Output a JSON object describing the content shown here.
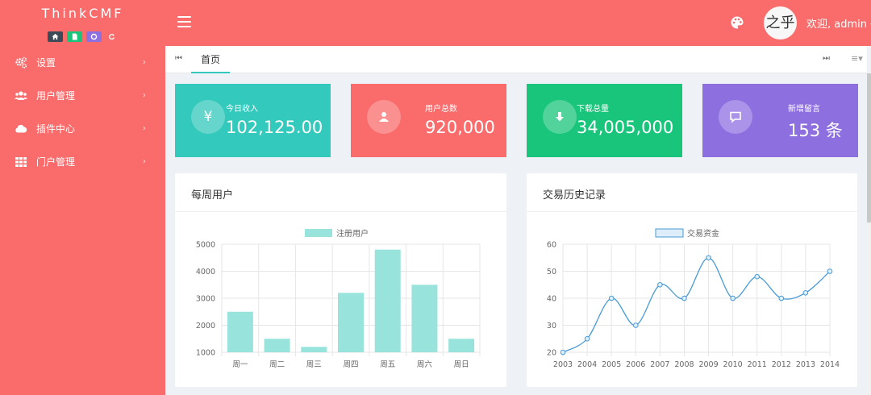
{
  "sidebar": {
    "brand": "ThinkCMF",
    "quick_buttons": [
      {
        "icon": "home-icon",
        "color": "#3d4a57"
      },
      {
        "icon": "document-icon",
        "color": "#19c57a"
      },
      {
        "icon": "recycle-icon",
        "color": "#8e6fe0"
      },
      {
        "icon": "refresh-icon",
        "color": "transparent"
      }
    ],
    "items": [
      {
        "label": "设置",
        "icon": "gears-icon"
      },
      {
        "label": "用户管理",
        "icon": "users-icon"
      },
      {
        "label": "插件中心",
        "icon": "cloud-icon"
      },
      {
        "label": "门户管理",
        "icon": "grid-icon"
      }
    ]
  },
  "navbar": {
    "welcome": "欢迎, admin",
    "avatar_text": "之乎",
    "theme_icon": "palette-icon",
    "menu_icon": "hamburger-icon"
  },
  "tabs": {
    "home": "首页",
    "prev_icon": "⏮",
    "next_icon": "⏭",
    "menu_icon": "≡▾"
  },
  "stats": [
    {
      "label": "今日收入",
      "value": "102,125.00",
      "icon": "yen-icon",
      "color": "#33c9bc"
    },
    {
      "label": "用户总数",
      "value": "920,000",
      "icon": "user-icon",
      "color": "#fa6b6b"
    },
    {
      "label": "下载总量",
      "value": "34,005,000",
      "icon": "download-icon",
      "color": "#19c57a"
    },
    {
      "label": "新增留言",
      "value": "153 条",
      "icon": "comment-icon",
      "color": "#8e6fe0"
    }
  ],
  "panels": {
    "weekly_title": "每周用户",
    "history_title": "交易历史记录"
  },
  "chart_data": [
    {
      "type": "bar",
      "title": "每周用户",
      "categories": [
        "周一",
        "周二",
        "周三",
        "周四",
        "周五",
        "周六",
        "周日"
      ],
      "series": [
        {
          "name": "注册用户",
          "values": [
            2500,
            1500,
            1200,
            3200,
            4800,
            3500,
            1500
          ]
        }
      ],
      "ylim": [
        1000,
        5000
      ],
      "yticks": [
        1000,
        2000,
        3000,
        4000,
        5000
      ],
      "grid": true,
      "legend": "top-center",
      "color": "#98e3dc"
    },
    {
      "type": "line",
      "title": "交易历史记录",
      "x": [
        "2003",
        "2004",
        "2005",
        "2006",
        "2007",
        "2008",
        "2009",
        "2010",
        "2011",
        "2012",
        "2013",
        "2014"
      ],
      "series": [
        {
          "name": "交易资金",
          "values": [
            20,
            25,
            40,
            30,
            45,
            40,
            55,
            40,
            48,
            40,
            42,
            50
          ]
        }
      ],
      "ylim": [
        20,
        60
      ],
      "yticks": [
        20,
        30,
        40,
        50,
        60
      ],
      "grid": true,
      "legend": "top-center",
      "color": "#4a9bd6"
    }
  ]
}
